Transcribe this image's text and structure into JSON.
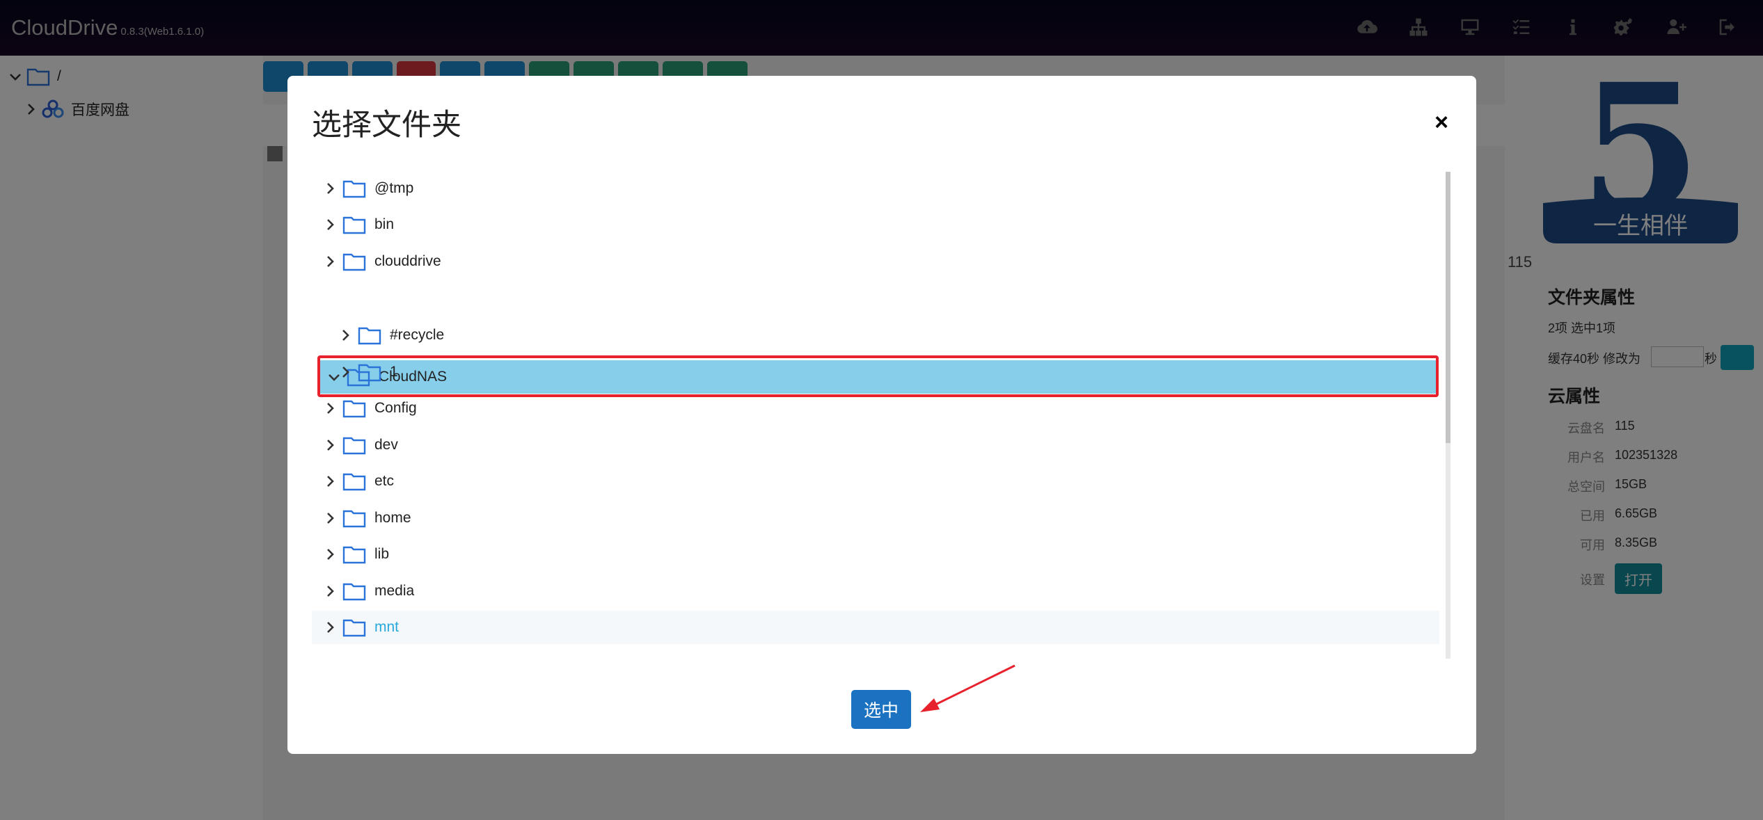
{
  "app": {
    "name": "CloudDrive",
    "version": "0.8.3(Web1.6.1.0)"
  },
  "nav_icons": [
    "cloud-upload-icon",
    "network-icon",
    "desktop-icon",
    "tasks-icon",
    "info-icon",
    "gears-icon",
    "add-user-icon",
    "logout-icon"
  ],
  "sidebar": {
    "root_label": "/",
    "items": [
      {
        "label": "百度网盘",
        "icon": "baidu-cloud-icon"
      }
    ]
  },
  "right_panel": {
    "logo_number": "5",
    "logo_caption": "一生相伴",
    "drive_label": "115",
    "folder_props_title": "文件夹属性",
    "summary": "2项  选中1项",
    "cache_text": "缓存40秒  修改为",
    "seconds_suffix": "秒",
    "cloud_props_title": "云属性",
    "props": [
      {
        "label": "云盘名",
        "value": "115"
      },
      {
        "label": "用户名",
        "value": "102351328"
      },
      {
        "label": "总空间",
        "value": "15GB"
      },
      {
        "label": "已用",
        "value": "6.65GB"
      },
      {
        "label": "可用",
        "value": "8.35GB"
      }
    ],
    "settings_label": "设置",
    "open_button": "打开"
  },
  "modal": {
    "title": "选择文件夹",
    "close_symbol": "×",
    "folders": [
      {
        "label": "@tmp",
        "level": 0,
        "expanded": false
      },
      {
        "label": "bin",
        "level": 0,
        "expanded": false
      },
      {
        "label": "clouddrive",
        "level": 0,
        "expanded": false
      },
      {
        "label": "CloudNAS",
        "level": 0,
        "expanded": true,
        "selected": true
      },
      {
        "label": "#recycle",
        "level": 1,
        "expanded": false
      },
      {
        "label": "1",
        "level": 1,
        "expanded": false
      },
      {
        "label": "Config",
        "level": 0,
        "expanded": false
      },
      {
        "label": "dev",
        "level": 0,
        "expanded": false
      },
      {
        "label": "etc",
        "level": 0,
        "expanded": false
      },
      {
        "label": "home",
        "level": 0,
        "expanded": false
      },
      {
        "label": "lib",
        "level": 0,
        "expanded": false
      },
      {
        "label": "media",
        "level": 0,
        "expanded": false
      },
      {
        "label": "mnt",
        "level": 0,
        "expanded": false,
        "hover": true
      }
    ],
    "select_button": "选中"
  },
  "colors": {
    "selected_row": "#87ceeb",
    "highlight_outline": "#e8222c",
    "primary_button": "#1b72c0",
    "hover_text": "#29a8de"
  }
}
